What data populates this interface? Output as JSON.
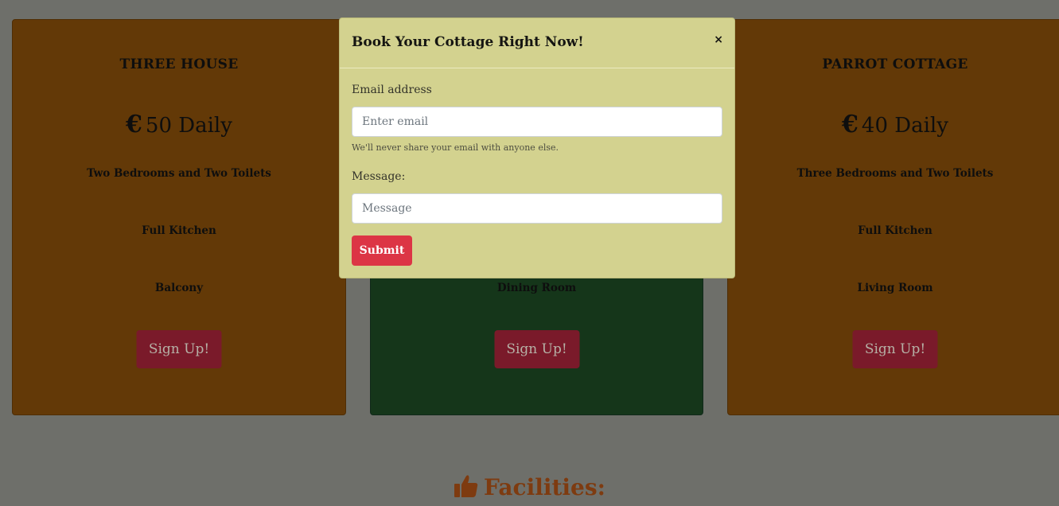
{
  "cards": [
    {
      "title": "THREE HOUSE",
      "currency": "€",
      "price": "50 Daily",
      "features": [
        "Two Bedrooms and Two Toilets",
        "Full Kitchen",
        "Balcony"
      ],
      "button": "Sign Up!"
    },
    {
      "title": "",
      "currency": "",
      "price": "",
      "features": [
        "",
        "",
        "Dining Room"
      ],
      "button": "Sign Up!"
    },
    {
      "title": "PARROT COTTAGE",
      "currency": "€",
      "price": "40 Daily",
      "features": [
        "Three Bedrooms and Two Toilets",
        "Full Kitchen",
        "Living Room"
      ],
      "button": "Sign Up!"
    }
  ],
  "section": {
    "heading": "Facilities:",
    "icon": "thumbs-up-icon"
  },
  "modal": {
    "title": "Book Your Cottage Right Now!",
    "close": "×",
    "email_label": "Email address",
    "email_placeholder": "Enter email",
    "email_help": "We'll never share your email with anyone else.",
    "message_label": "Message:",
    "message_placeholder": "Message",
    "submit": "Submit"
  },
  "colors": {
    "overlay": "#6e6f6a",
    "card_orange": "#633907",
    "card_green": "#15361a",
    "signup_button": "#7a1a2a",
    "modal_bg": "#d3d28f",
    "submit_button": "#dc3545",
    "facilities_heading": "#7e3b10"
  }
}
